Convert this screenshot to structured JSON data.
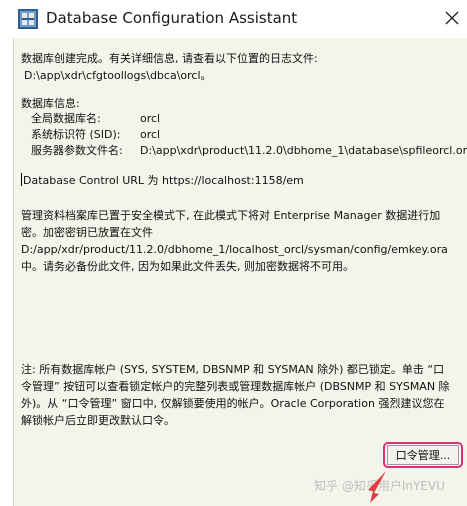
{
  "window": {
    "title": "Database Configuration Assistant",
    "close_glyph": "✕"
  },
  "content": {
    "intro_line1": "数据库创建完成。有关详细信息, 请查看以下位置的日志文件:",
    "intro_line2": "D:\\app\\xdr\\cfgtoollogs\\dbca\\orcl。",
    "db_info_header": "数据库信息:",
    "db_info": [
      {
        "label": "全局数据库名:",
        "value": "orcl"
      },
      {
        "label": "系统标识符 (SID):",
        "value": "orcl"
      },
      {
        "label": "服务器参数文件名:",
        "value": "D:\\app\\xdr\\product\\11.2.0\\dbhome_1\\database\\spfileorcl.ora"
      }
    ],
    "control_url": "Database Control URL 为 https://localhost:1158/em",
    "secure_mode": "管理资料档案库已置于安全模式下, 在此模式下将对 Enterprise Manager 数据进行加密。加密密钥已放置在文件 D:/app/xdr/product/11.2.0/dbhome_1/localhost_orcl/sysman/config/emkey.ora 中。请务必备份此文件, 因为如果此文件丢失, 则加密数据将不可用。",
    "note": "注: 所有数据库帐户 (SYS, SYSTEM, DBSNMP 和 SYSMAN 除外) 都已锁定。单击 “口令管理” 按钮可以查看锁定帐户的完整列表或管理数据库帐户 (DBSNMP 和 SYSMAN 除外)。从 “口令管理” 窗口中, 仅解锁要使用的帐户。Oracle Corporation 强烈建议您在解锁帐户后立即更改默认口令。"
  },
  "buttons": {
    "password_mgmt": "口令管理..."
  },
  "watermark": "知乎 @知乎用户InYEVU",
  "colors": {
    "client_bg": "#f5f4eb",
    "highlight": "#d8317a",
    "arrow": "#e03a45"
  },
  "icons": {
    "app": "database-app-icon",
    "close": "close-icon",
    "cursor": "arrow-cursor-icon"
  }
}
